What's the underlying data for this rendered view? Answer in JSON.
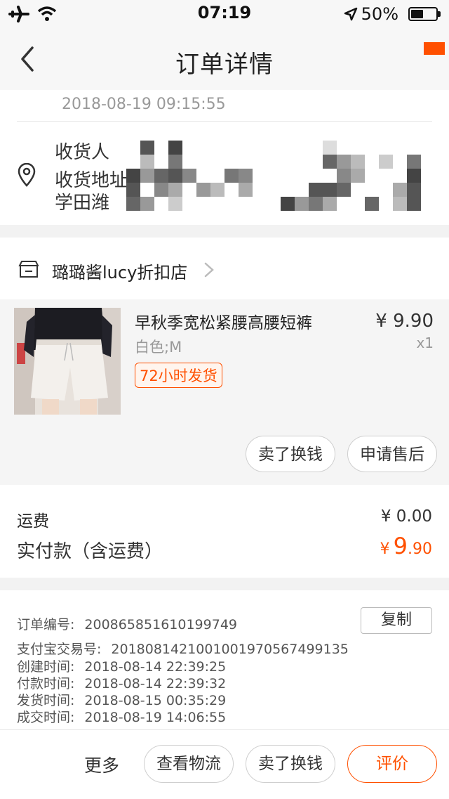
{
  "status_bar": {
    "time": "07:19",
    "battery_pct": "50%",
    "battery_level": 0.5,
    "icons": [
      "airplane-icon",
      "wifi-icon",
      "location-arrow-icon",
      "battery-icon"
    ]
  },
  "nav": {
    "title": "订单详情",
    "back_icon": "chevron-left-icon"
  },
  "order_status": {
    "time": "2018-08-19 09:15:55"
  },
  "address": {
    "lines": [
      "收货人",
      "收货地址",
      "学田潍"
    ]
  },
  "shop": {
    "name": "璐璐酱lucy折扣店"
  },
  "item": {
    "title": "早秋季宽松紧腰高腰短裤",
    "sku": "白色;M",
    "tag": "72小时发货",
    "price": "¥ 9.90",
    "qty": "x1",
    "actions": [
      "卖了换钱",
      "申请售后"
    ]
  },
  "summary": {
    "fee_label": "运费",
    "fee_value": "¥ 0.00",
    "total_label": "实付款（含运费）",
    "total_currency": "¥",
    "total_int": "9",
    "total_dec": ".90"
  },
  "order_info": {
    "copy_label": "复制",
    "rows": [
      {
        "k": "订单编号:",
        "v": "200865851610199749"
      },
      {
        "k": "支付宝交易号:",
        "v": "2018081421001001970567499135"
      },
      {
        "k": "创建时间:",
        "v": "2018-08-14 22:39:25"
      },
      {
        "k": "付款时间:",
        "v": "2018-08-14 22:39:32"
      },
      {
        "k": "发货时间:",
        "v": "2018-08-15 00:35:29"
      },
      {
        "k": "成交时间:",
        "v": "2018-08-19 14:06:55"
      }
    ]
  },
  "bottom_bar": {
    "more": "更多",
    "buttons": [
      "查看物流",
      "卖了换钱",
      "评价"
    ]
  },
  "colors": {
    "accent": "#ff5000",
    "bg": "#f2f2f2"
  }
}
